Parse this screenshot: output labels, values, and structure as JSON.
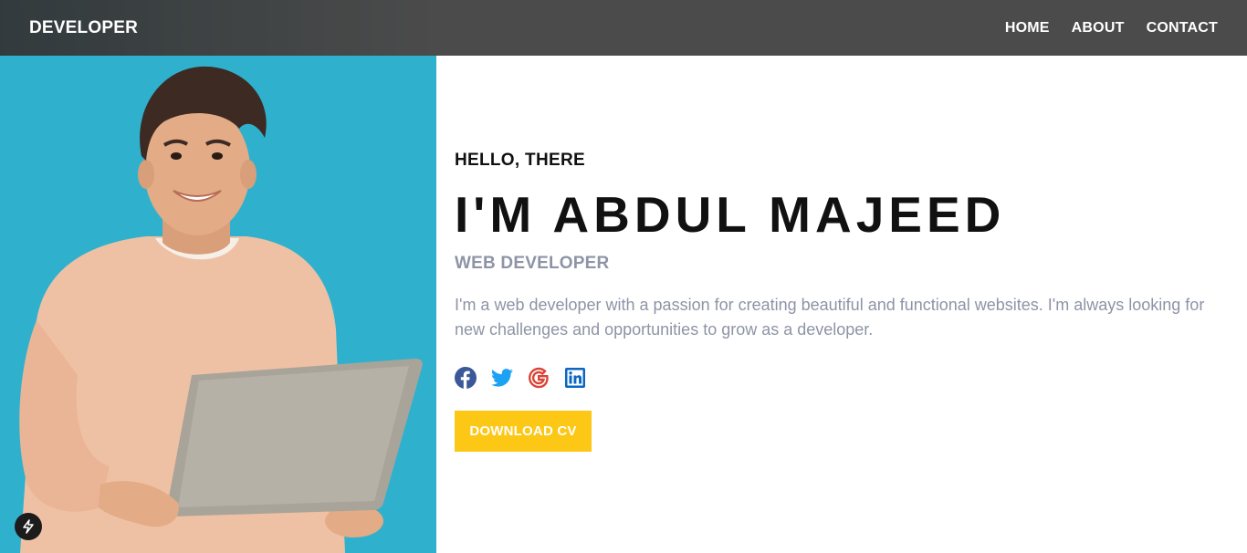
{
  "header": {
    "brand": "DEVELOPER",
    "nav": [
      {
        "label": "HOME"
      },
      {
        "label": "ABOUT"
      },
      {
        "label": "CONTACT"
      }
    ]
  },
  "hero": {
    "greeting": "HELLO, THERE",
    "name": "I'M ABDUL MAJEED",
    "role": "WEB DEVELOPER",
    "bio": "I'm a web developer with a passion for creating beautiful and functional websites. I'm always looking for new challenges and opportunities to grow as a developer.",
    "download_label": "DOWNLOAD CV",
    "socials": [
      {
        "icon": "facebook-icon",
        "color": "#3b5998"
      },
      {
        "icon": "twitter-icon",
        "color": "#1da1f2"
      },
      {
        "icon": "google-icon",
        "color": "#db4437"
      },
      {
        "icon": "linkedin-icon",
        "color": "#0a66c2"
      }
    ]
  },
  "colors": {
    "navbar": "#4b4b4b",
    "photo_background": "#2fb1ce",
    "accent": "#fdc716",
    "muted_text": "#8e94a6"
  },
  "badge": {
    "icon": "lightning-icon"
  }
}
